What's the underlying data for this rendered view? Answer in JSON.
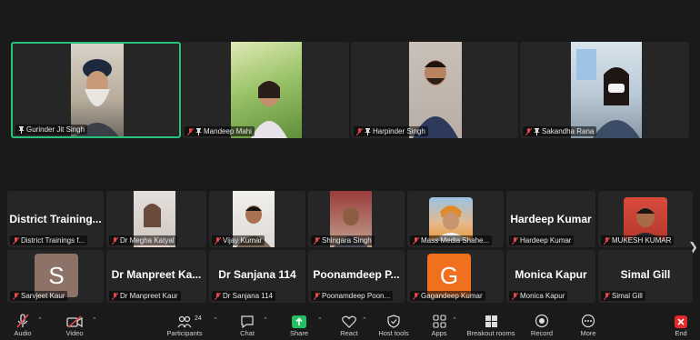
{
  "top_row": [
    {
      "name": "Gurinder Jit Singh",
      "muted": false
    },
    {
      "name": "Mandeep Mahi",
      "muted": true
    },
    {
      "name": "Harpinder Singh",
      "muted": true
    },
    {
      "name": "Sakandha Rana",
      "muted": true
    }
  ],
  "strip_row1": [
    {
      "big": "District Training...",
      "name": "District Trainings f..."
    },
    {
      "big": "",
      "name": "Dr Megha Katyal"
    },
    {
      "big": "",
      "name": "Vijay Kumar"
    },
    {
      "big": "",
      "name": "Shingara Singh"
    },
    {
      "big": "",
      "name": "Mass Media Shahe..."
    },
    {
      "big": "Hardeep Kumar",
      "name": "Hardeep Kumar"
    },
    {
      "big": "",
      "name": "MUKESH KUMAR"
    }
  ],
  "strip_row2": [
    {
      "big": "",
      "avatar": "S",
      "name": "Sarvjeet Kaur"
    },
    {
      "big": "Dr Manpreet Ka...",
      "name": "Dr Manpreet Kaur"
    },
    {
      "big": "Dr Sanjana 114",
      "name": "Dr Sanjana 114"
    },
    {
      "big": "Poonamdeep P...",
      "name": "Poonamdeep Poon..."
    },
    {
      "big": "",
      "avatar": "G",
      "name": "Gagandeep Kumar"
    },
    {
      "big": "Monica Kapur",
      "name": "Monica Kapur"
    },
    {
      "big": "Simal Gill",
      "name": "Simal Gill"
    }
  ],
  "toolbar": {
    "audio": "Audio",
    "video": "Video",
    "participants": "Participants",
    "participant_count": "24",
    "chat": "Chat",
    "share": "Share",
    "react": "React",
    "host_tools": "Host tools",
    "apps": "Apps",
    "breakout": "Breakout rooms",
    "record": "Record",
    "more": "More",
    "end": "End"
  },
  "colors": {
    "active_border": "#27c27a",
    "share_green": "#23c063",
    "muted_red": "#e5484d",
    "end_red": "#e02a2a",
    "avatar_s": "#8d7268",
    "avatar_g": "#f0701e"
  }
}
